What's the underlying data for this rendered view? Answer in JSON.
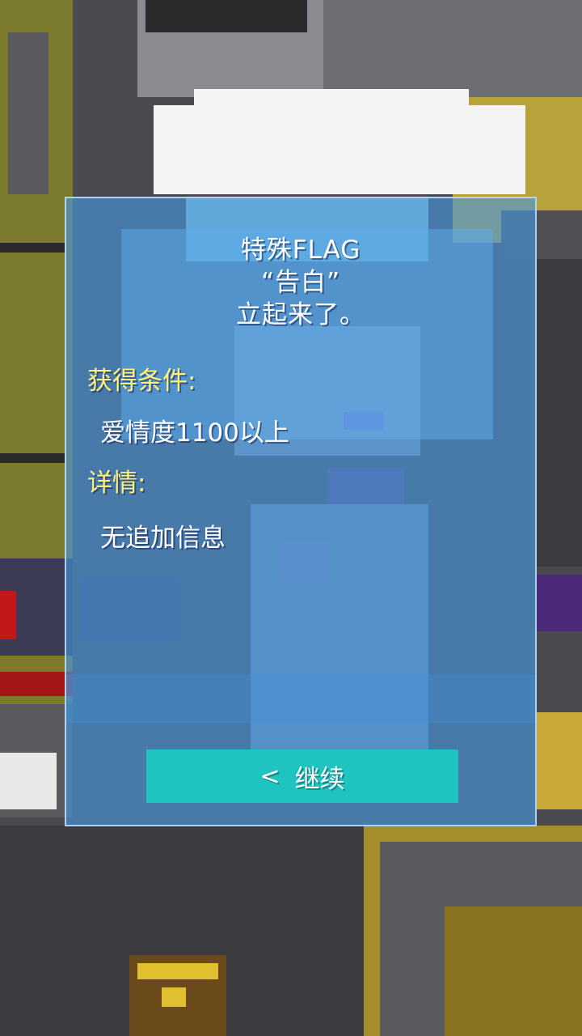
{
  "dialog": {
    "title_line1": "特殊FLAG",
    "title_line2": "“告白”",
    "title_line3": "立起来了。",
    "condition_label": "获得条件:",
    "condition_value": "爱情度1100以上",
    "detail_label": "详情:",
    "detail_value": "无追加信息",
    "continue_label": "继续",
    "continue_icon": "chevron-left-icon"
  },
  "colors": {
    "dialog_bg": "#4696e1",
    "label_yellow": "#fff27a",
    "button_teal": "#1fc3c0",
    "text_white": "#ffffff"
  }
}
